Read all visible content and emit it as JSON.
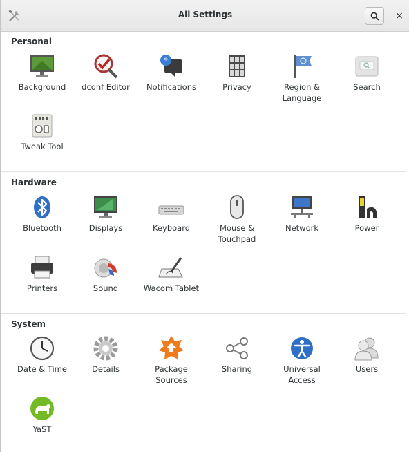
{
  "header": {
    "title": "All Settings",
    "search_icon": "search-icon",
    "close_label": "×",
    "tools_icon": "tools-icon"
  },
  "sections": {
    "personal": {
      "title": "Personal",
      "items": [
        "Background",
        "dconf Editor",
        "Notifications",
        "Privacy",
        "Region &\nLanguage",
        "Search",
        "Tweak Tool"
      ]
    },
    "hardware": {
      "title": "Hardware",
      "items": [
        "Bluetooth",
        "Displays",
        "Keyboard",
        "Mouse &\nTouchpad",
        "Network",
        "Power",
        "Printers",
        "Sound",
        "Wacom Tablet"
      ]
    },
    "system": {
      "title": "System",
      "items": [
        "Date & Time",
        "Details",
        "Package\nSources",
        "Sharing",
        "Universal\nAccess",
        "Users",
        "YaST"
      ]
    }
  }
}
